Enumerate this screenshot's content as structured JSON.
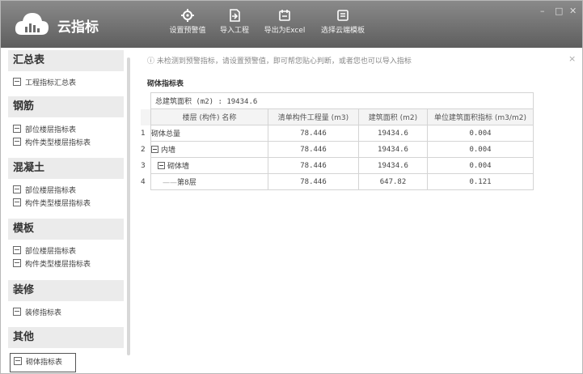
{
  "app": {
    "name": "云指标"
  },
  "toolbar": {
    "items": [
      {
        "label": "设置预警值",
        "icon": "gear-icon"
      },
      {
        "label": "导入工程",
        "icon": "import-icon"
      },
      {
        "label": "导出为Excel",
        "icon": "export-excel-icon"
      },
      {
        "label": "选择云端模板",
        "icon": "cloud-template-icon"
      }
    ]
  },
  "window": {
    "minimize": "–",
    "maximize": "□",
    "close": "✕"
  },
  "sidebar": {
    "sections": [
      {
        "title": "汇总表",
        "items": [
          "工程指标汇总表"
        ]
      },
      {
        "title": "钢筋",
        "items": [
          "部位楼层指标表",
          "构件类型楼层指标表"
        ]
      },
      {
        "title": "混凝土",
        "items": [
          "部位楼层指标表",
          "构件类型楼层指标表"
        ]
      },
      {
        "title": "模板",
        "items": [
          "部位楼层指标表",
          "构件类型楼层指标表"
        ]
      },
      {
        "title": "装修",
        "items": [
          "装修指标表"
        ]
      },
      {
        "title": "其他",
        "items": [
          "砌体指标表"
        ]
      }
    ]
  },
  "notice": {
    "text": "ⓘ 未检测到预警指标，请设置预警值，即可帮您贴心判断，或者您也可以导入指标",
    "close": "×"
  },
  "table": {
    "title": "砌体指标表",
    "total_area": "总建筑面积 (m2) : 19434.6",
    "headers": [
      "楼层 (构件) 名称",
      "清单构件工程量 (m3)",
      "建筑面积 (m2)",
      "单位建筑面积指标 (m3/m2)"
    ],
    "rows": [
      {
        "no": "1",
        "name": "砌体总量",
        "qty": "78.446",
        "area": "19434.6",
        "index": "0.004"
      },
      {
        "no": "2",
        "name": "内墙",
        "qty": "78.446",
        "area": "19434.6",
        "index": "0.004"
      },
      {
        "no": "3",
        "name": "砌体墙",
        "qty": "78.446",
        "area": "19434.6",
        "index": "0.004"
      },
      {
        "no": "4",
        "name": "第8层",
        "qty": "78.446",
        "area": "647.82",
        "index": "0.121"
      }
    ]
  }
}
